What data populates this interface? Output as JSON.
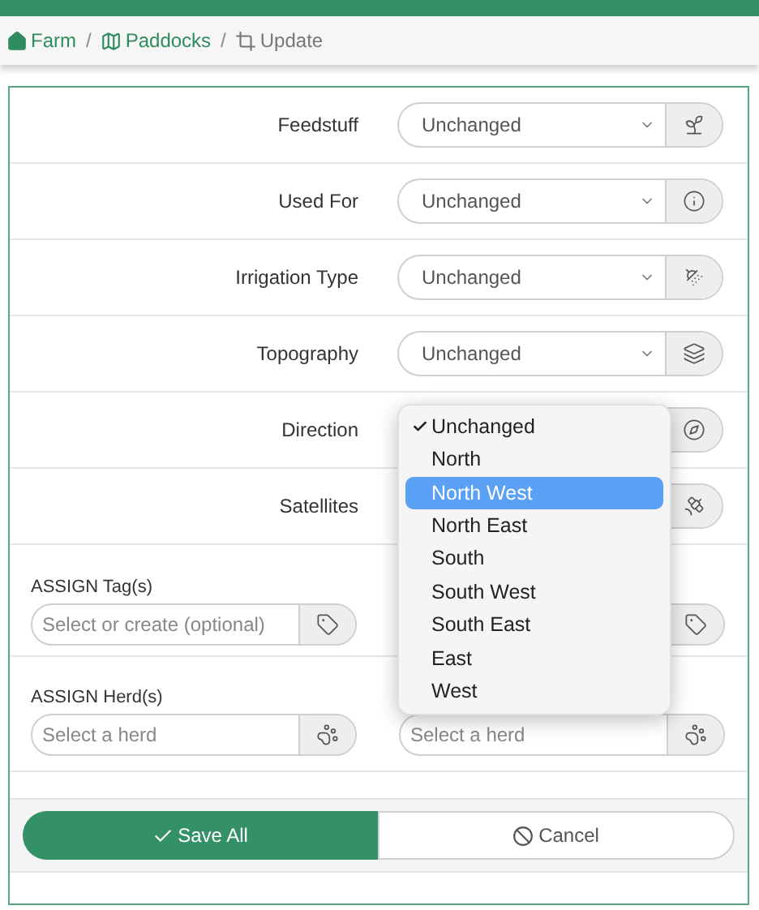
{
  "breadcrumbs": [
    {
      "label": "Farm",
      "link": true
    },
    {
      "label": "Paddocks",
      "link": true,
      "separator": "/"
    },
    {
      "label": "Update",
      "link": false,
      "separator": "/"
    }
  ],
  "fields": [
    {
      "label": "Feedstuff",
      "value": "Unchanged"
    },
    {
      "label": "Used For",
      "value": "Unchanged"
    },
    {
      "label": "Irrigation Type",
      "value": "Unchanged"
    },
    {
      "label": "Topography",
      "value": "Unchanged"
    },
    {
      "label": "Direction"
    },
    {
      "label": "Satellites"
    }
  ],
  "assign": [
    {
      "label": "ASSIGN Tag(s)",
      "placeholder": "Select or create (optional)"
    },
    {
      "label": "ASSIGN Herd(s)",
      "placeholder": "Select a herd",
      "right_placeholder": "Select a herd"
    }
  ],
  "dropdown": {
    "options": [
      {
        "label": "Unchanged",
        "checked": true,
        "selected": false
      },
      {
        "label": "North",
        "checked": false,
        "selected": false
      },
      {
        "label": "North West",
        "checked": false,
        "selected": true
      },
      {
        "label": "North East",
        "checked": false,
        "selected": false
      },
      {
        "label": "South",
        "checked": false,
        "selected": false
      },
      {
        "label": "South West",
        "checked": false,
        "selected": false
      },
      {
        "label": "South East",
        "checked": false,
        "selected": false
      },
      {
        "label": "East",
        "checked": false,
        "selected": false
      },
      {
        "label": "West",
        "checked": false,
        "selected": false
      }
    ]
  },
  "buttons": [
    {
      "label": "Save All",
      "kind": "primary"
    },
    {
      "label": "Cancel",
      "kind": "secondary"
    }
  ]
}
